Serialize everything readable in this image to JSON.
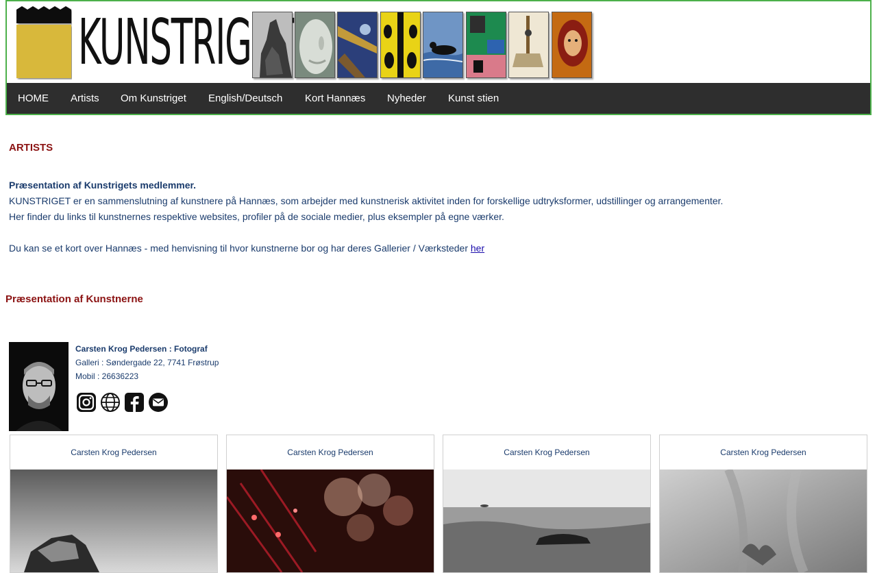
{
  "brand": {
    "name": "KUNSTRIGET",
    "logo_color": "#d8b83a",
    "frame_color": "#4cb04a"
  },
  "nav": {
    "items": [
      {
        "label": "HOME"
      },
      {
        "label": "Artists"
      },
      {
        "label": "Om Kunstriget"
      },
      {
        "label": "English/Deutsch"
      },
      {
        "label": "Kort Hannæs"
      },
      {
        "label": "Nyheder"
      },
      {
        "label": "Kunst stien"
      }
    ]
  },
  "page": {
    "heading": "ARTISTS",
    "intro_bold": "Præsentation af Kunstrigets medlemmer.",
    "intro_line1": "KUNSTRIGET er en sammenslutning af kunstnere på Hannæs, som arbejder med kunstnerisk aktivitet inden for forskellige udtryksformer, udstillinger og arrangementer.",
    "intro_line2": "Her finder du links til kunstnernes respektive websites, profiler på de sociale medier, plus eksempler på egne værker.",
    "map_text": "Du kan se et kort over Hannæs - med henvisning til hvor kunstnerne bor og har deres Gallerier / Værksteder ",
    "map_link": "her",
    "section_heading": "Præsentation af Kunstnerne"
  },
  "artist": {
    "name_title": "Carsten Krog Pedersen : Fotograf",
    "gallery": "Galleri : Søndergade 22, 7741 Frøstrup",
    "mobile": "Mobil : 26636223",
    "social_icons": [
      "instagram-icon",
      "globe-icon",
      "facebook-icon",
      "email-icon"
    ]
  },
  "gallery": {
    "cards": [
      {
        "caption": "Carsten Krog Pedersen"
      },
      {
        "caption": "Carsten Krog Pedersen"
      },
      {
        "caption": "Carsten Krog Pedersen"
      },
      {
        "caption": "Carsten Krog Pedersen"
      }
    ]
  },
  "colors": {
    "heading_red": "#8b1212",
    "text_blue": "#1a3b6c",
    "nav_bg": "#2e2e2e"
  }
}
